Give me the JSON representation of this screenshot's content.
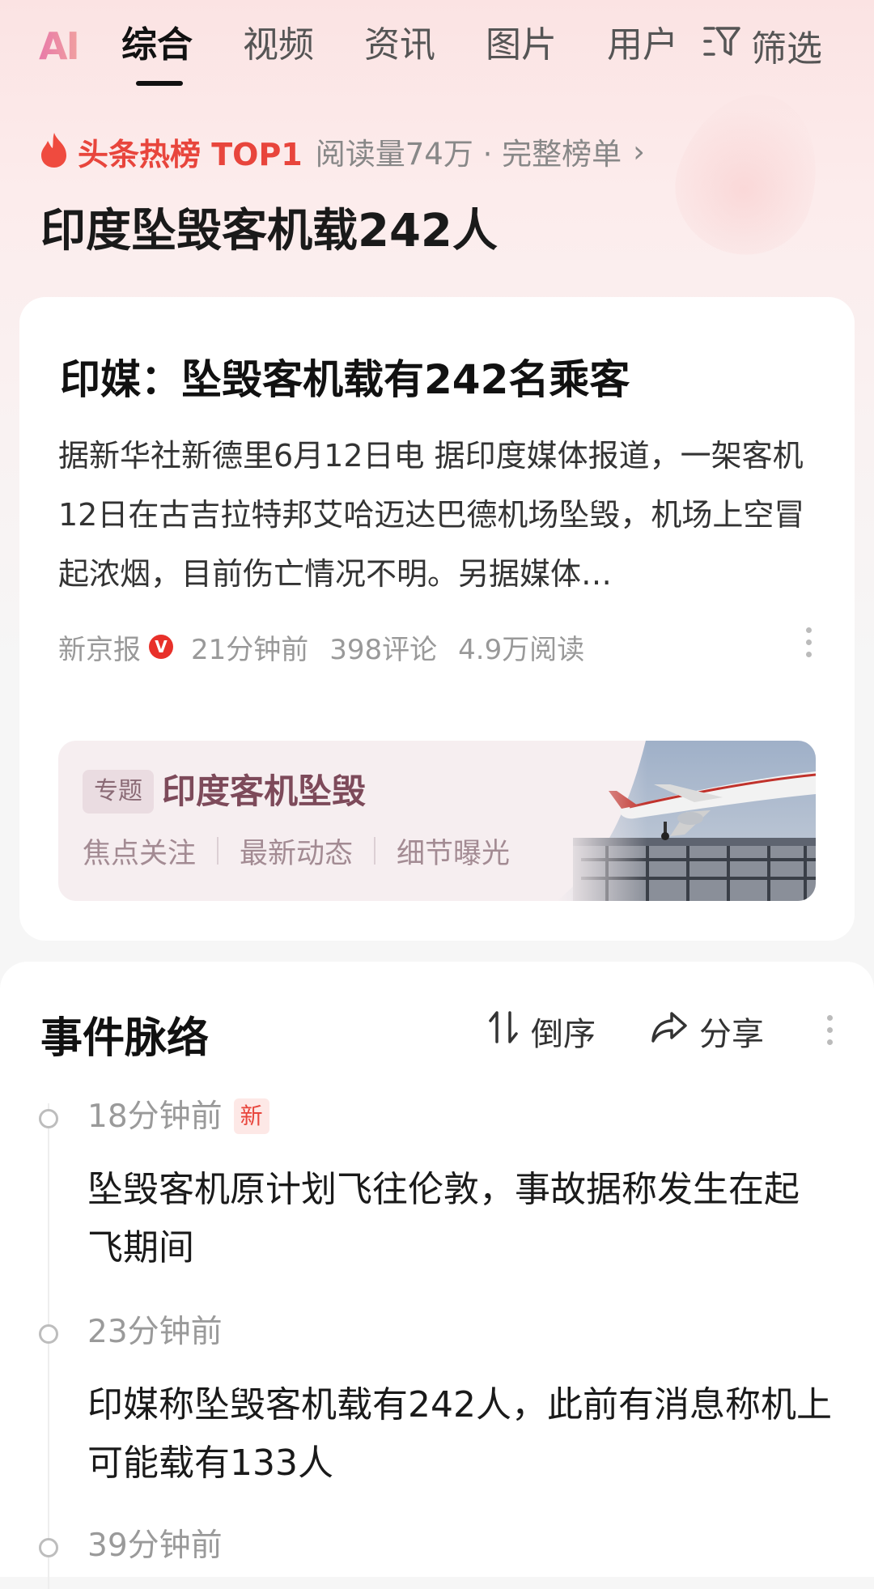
{
  "tabs": {
    "logo": "AI",
    "items": [
      "综合",
      "视频",
      "资讯",
      "图片",
      "用户"
    ],
    "filter_label": "筛选"
  },
  "hot": {
    "badge": "头条热榜 TOP1",
    "meta": "阅读量74万 · 完整榜单",
    "topic": "印度坠毁客机载242人"
  },
  "article": {
    "title": "印媒：坠毁客机载有242名乘客",
    "summary": "据新华社新德里6月12日电 据印度媒体报道，一架客机12日在古吉拉特邦艾哈迈达巴德机场坠毁，机场上空冒起浓烟，目前伤亡情况不明。另据媒体…",
    "source": "新京报",
    "verified_mark": "V",
    "time": "21分钟前",
    "comments": "398评论",
    "reads": "4.9万阅读"
  },
  "special": {
    "tag": "专题",
    "title": "印度客机坠毁",
    "links": [
      "焦点关注",
      "最新动态",
      "细节曝光"
    ]
  },
  "timeline": {
    "title": "事件脉络",
    "sort_label": "倒序",
    "share_label": "分享",
    "new_badge": "新",
    "items": [
      {
        "time": "18分钟前",
        "text": "坠毁客机原计划飞往伦敦，事故据称发生在起飞期间"
      },
      {
        "time": "23分钟前",
        "text": "印媒称坠毁客机载有242人，此前有消息称机上可能载有133人"
      },
      {
        "time": "39分钟前",
        "text": ""
      }
    ]
  },
  "colors": {
    "accent_red": "#e8453c",
    "special_title": "#7d4a5a"
  }
}
